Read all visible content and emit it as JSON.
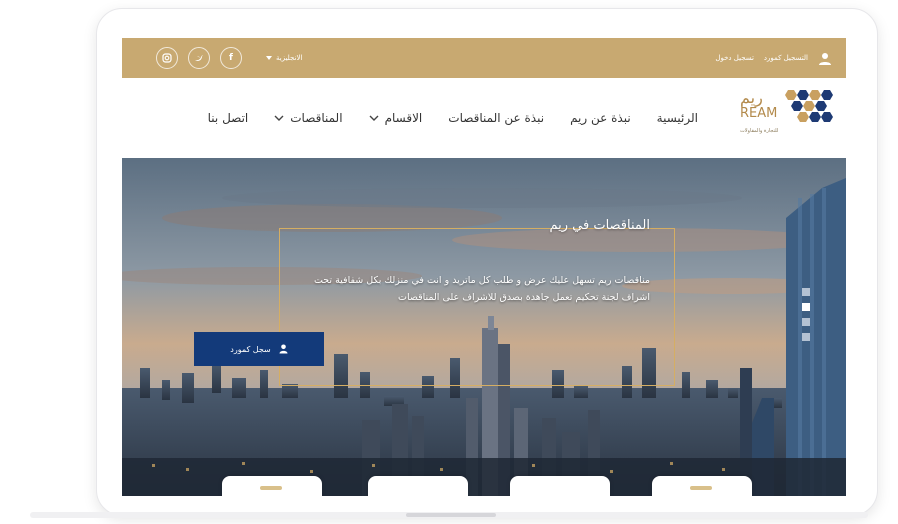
{
  "topbar": {
    "register_label": "التسجيل كمورد",
    "login_label": "تسجيل دخول",
    "language_label": "الانجليزية",
    "social_icons": [
      "facebook-icon",
      "twitter-icon",
      "instagram-icon"
    ]
  },
  "logo": {
    "arabic_name": "ريم",
    "english_name": "REAM",
    "tagline": "للتجارة والمقاولات"
  },
  "nav": {
    "items": [
      {
        "label": "الرئيسية",
        "dropdown": false
      },
      {
        "label": "نبذة عن ريم",
        "dropdown": false
      },
      {
        "label": "نبذة عن المناقصات",
        "dropdown": false
      },
      {
        "label": "الاقسام",
        "dropdown": true
      },
      {
        "label": "المناقصات",
        "dropdown": true
      },
      {
        "label": "اتصل بنا",
        "dropdown": false
      }
    ]
  },
  "hero": {
    "title": "المناقصات في ريم",
    "description": "مناقصات ريم تسهل عليك عرض و طلب كل ماتريد و انت في منزلك بكل شفافية تحت اشراف لجنة تحكيم تعمل جاهدة بصدق للاشراف على المناقصات",
    "cta_label": "سجل كمورد",
    "slide_count": 4,
    "active_slide": 2
  },
  "colors": {
    "gold": "#c8a971",
    "navy": "#133a7a",
    "frame_gold": "#d5ae63"
  }
}
